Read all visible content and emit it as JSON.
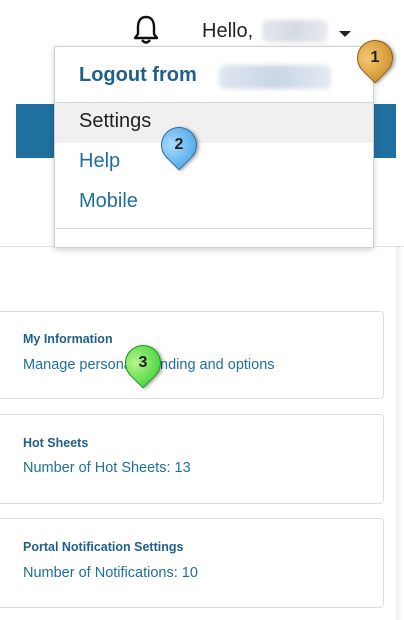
{
  "header": {
    "greeting": "Hello,",
    "bell_icon": "bell-icon",
    "caret_icon": "chevron-down-icon"
  },
  "dropdown": {
    "logout_label": "Logout from",
    "items": [
      {
        "label": "Settings"
      },
      {
        "label": "Help"
      },
      {
        "label": "Mobile"
      }
    ]
  },
  "cards": [
    {
      "title": "My Information",
      "subtitle": "Manage personal branding and options"
    },
    {
      "title": "Hot Sheets",
      "subtitle": "Number of Hot Sheets: 13"
    },
    {
      "title": "Portal Notification Settings",
      "subtitle": "Number of Notifications: 10"
    }
  ],
  "callouts": [
    {
      "number": "1",
      "color": "#d39a34"
    },
    {
      "number": "2",
      "color": "#3c9ee5"
    },
    {
      "number": "3",
      "color": "#2fcf2f"
    }
  ],
  "colors": {
    "link": "#1f6f9f",
    "heading": "#1f5f8a",
    "strip": "#1f6f9f"
  }
}
